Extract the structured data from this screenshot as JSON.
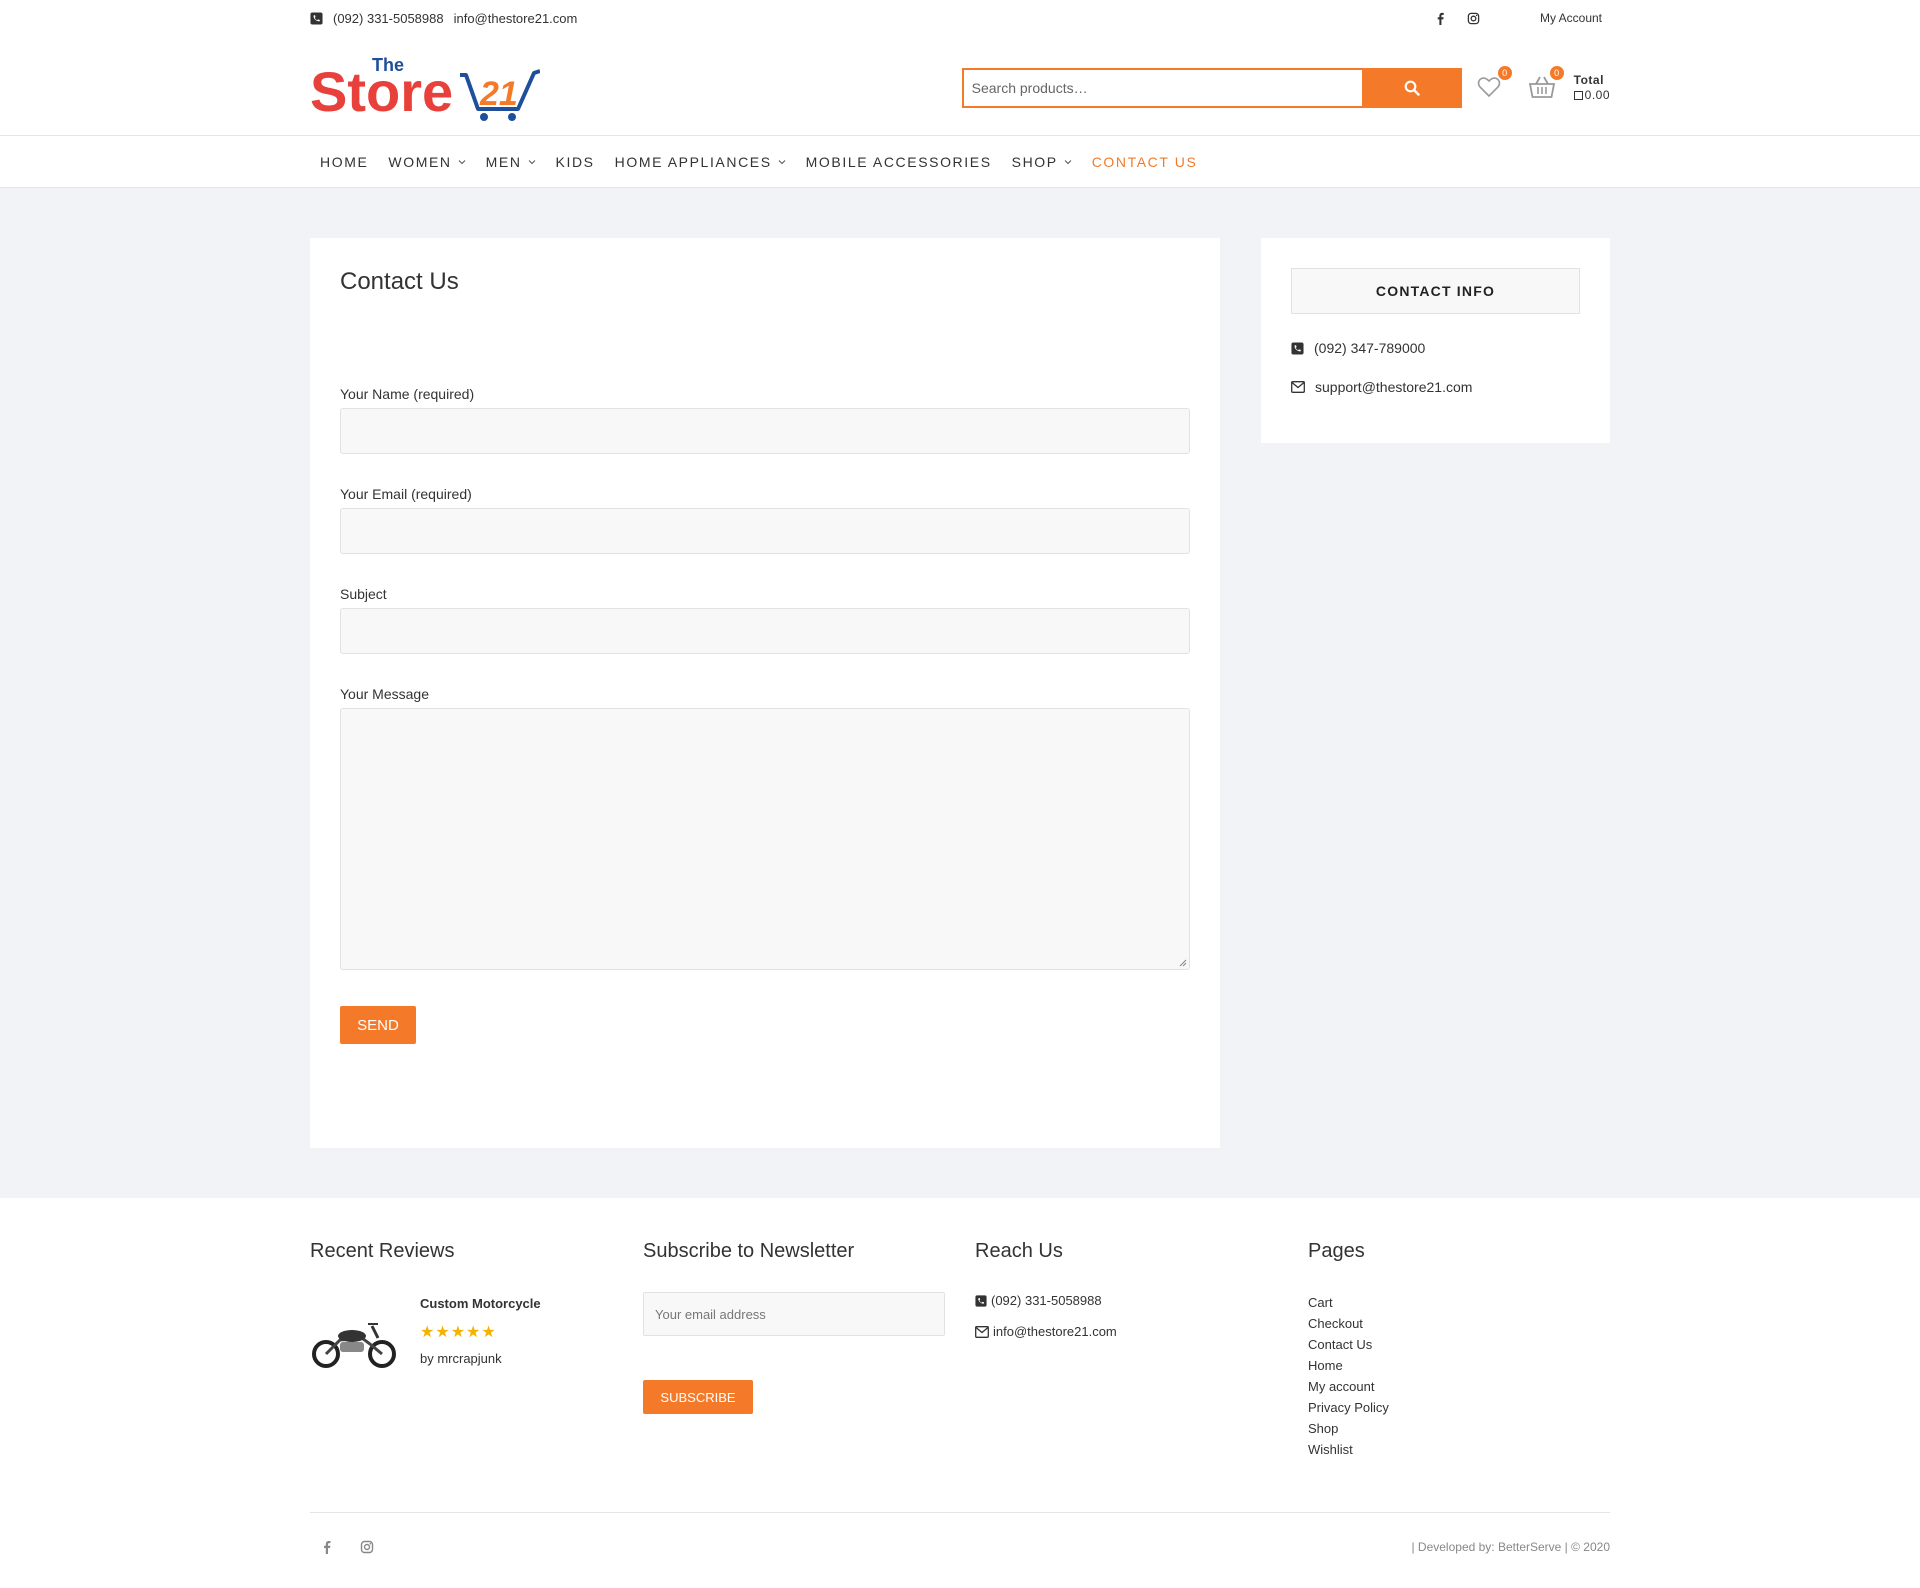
{
  "topbar": {
    "phone": "(092) 331-5058988",
    "email": "info@thestore21.com",
    "my_account": "My Account"
  },
  "header": {
    "logo_text_the": "The",
    "logo_text_store": "Store",
    "logo_text_num": "21",
    "search_placeholder": "Search products…",
    "wishlist_count": "0",
    "cart_count": "0",
    "total_label": "Total",
    "total_value": "0.00"
  },
  "nav": {
    "items": [
      {
        "label": "HOME"
      },
      {
        "label": "WOMEN"
      },
      {
        "label": "MEN"
      },
      {
        "label": "KIDS"
      },
      {
        "label": "HOME APPLIANCES"
      },
      {
        "label": "MOBILE ACCESSORIES"
      },
      {
        "label": "SHOP"
      },
      {
        "label": "CONTACT US"
      }
    ]
  },
  "contact_form": {
    "title": "Contact Us",
    "name_label": "Your Name (required)",
    "email_label": "Your Email (required)",
    "subject_label": "Subject",
    "message_label": "Your Message",
    "send_label": "SEND"
  },
  "contact_info": {
    "title": "CONTACT INFO",
    "phone": "(092) 347-789000",
    "email": "support@thestore21.com"
  },
  "footer": {
    "reviews": {
      "title": "Recent Reviews",
      "product": "Custom Motorcycle",
      "stars": "★★★★★",
      "by": "by mrcrapjunk"
    },
    "newsletter": {
      "title": "Subscribe to Newsletter",
      "placeholder": "Your email address",
      "button": "SUBSCRIBE"
    },
    "reach": {
      "title": "Reach Us",
      "phone": "(092) 331-5058988",
      "email": "info@thestore21.com"
    },
    "pages": {
      "title": "Pages",
      "items": [
        "Cart",
        "Checkout",
        "Contact Us",
        "Home",
        "My account",
        "Privacy Policy",
        "Shop",
        "Wishlist"
      ]
    },
    "credits": "| Developed by: BetterServe | © 2020"
  },
  "colors": {
    "accent": "#f47a2a",
    "background": "#f2f3f7"
  }
}
